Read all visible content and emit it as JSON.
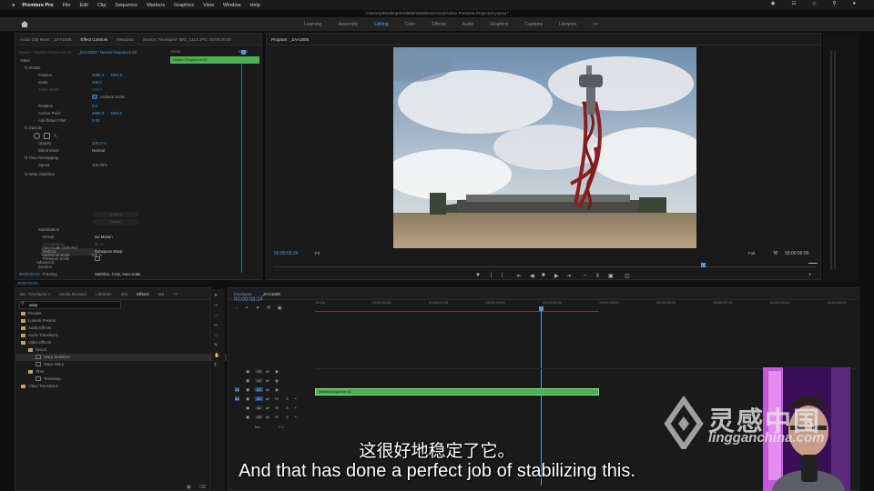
{
  "menubar": {
    "apple": "",
    "app_name": "Premiere Pro",
    "items": [
      "File",
      "Edit",
      "Clip",
      "Sequence",
      "Markers",
      "Graphics",
      "View",
      "Window",
      "Help"
    ]
  },
  "window_title": "/Users/rp/Desktop/ZA00DB/Stabilize(CH11)/Adobe Premiere Projects/1.prproj *",
  "workspaces": [
    "Learning",
    "Assembly",
    "Editing",
    "Color",
    "Effects",
    "Audio",
    "Graphics",
    "Captions",
    "Libraries",
    ">>"
  ],
  "active_workspace": "Editing",
  "effect_controls": {
    "tabs": [
      "Audio Clip Mixer: _ZAA1605",
      "Effect Controls",
      "Metadata",
      "Source: Timelapse: IMG_1414.JPG: 00:00:00:00"
    ],
    "master": "Master * Nested Sequence 03",
    "clip": "_ZAA1605 * Nested Sequence 03",
    "timecode_start": ":00:00",
    "timecode_end": "00:00",
    "clip_bar_label": "Nested Sequence 03",
    "section_video": "Video",
    "motion": "Motion",
    "position_label": "Position",
    "position_x": "2880.0",
    "position_y": "1910.0",
    "scale_label": "Scale",
    "scale_value": "100.0",
    "scale_width_label": "Scale Width",
    "scale_width_value": "100.0",
    "uniform_scale": "Uniform Scale",
    "rotation_label": "Rotation",
    "rotation_value": "0.0",
    "anchor_label": "Anchor Point",
    "anchor_x": "2880.0",
    "anchor_y": "1910.0",
    "antiflicker_label": "Anti-flicker Filter",
    "antiflicker_value": "0.00",
    "opacity_section": "Opacity",
    "opacity_label": "Opacity",
    "opacity_value": "100.0 %",
    "blend_label": "Blend Mode",
    "blend_value": "Normal",
    "remap_section": "Time Remapping",
    "speed_label": "Speed",
    "speed_value": "100.00%",
    "warp_section": "Warp Stabilizer",
    "analyze_btn": "Analyze",
    "cancel_btn": "Cancel",
    "stabilization_label": "Stabilization",
    "result_label": "Result",
    "result_value": "No Motion",
    "smoothness_label": "Smoothness",
    "smoothness_value": "50 %",
    "method_label": "Method",
    "method_value": "Subspace Warp",
    "preserve_label": "Preserve Scale",
    "borders_label": "Borders",
    "framing_label": "Framing",
    "framing_value": "Stabilize, Crop, Auto-scale",
    "autoscale_label": "Auto-scale (100.0%)",
    "addscale_label": "Additional Scale",
    "addscale_value": "100 %",
    "advanced_label": "Advanced",
    "footer_time": "00:00:03:24"
  },
  "program": {
    "tab": "Program: _ZAA1605",
    "timecode": "00:00:03:24",
    "fit": "Fit",
    "quality": "Full",
    "duration": "00:00:05:00"
  },
  "project_panel": {
    "tabs": [
      "Bin: Timelapse 1",
      "Media Browser",
      "Libraries",
      "Info",
      "Effects",
      "Ma",
      ">>"
    ],
    "active": "Effects",
    "search_value": "warp",
    "tree": [
      {
        "label": "Presets",
        "level": 0,
        "type": "folder"
      },
      {
        "label": "Lumetri Presets",
        "level": 0,
        "type": "folder"
      },
      {
        "label": "Audio Effects",
        "level": 0,
        "type": "folder"
      },
      {
        "label": "Audio Transitions",
        "level": 0,
        "type": "folder"
      },
      {
        "label": "Video Effects",
        "level": 0,
        "type": "folder"
      },
      {
        "label": "Distort",
        "level": 1,
        "type": "folder"
      },
      {
        "label": "Warp Stabilizer",
        "level": 2,
        "type": "effect",
        "selected": true
      },
      {
        "label": "Wave Warp",
        "level": 2,
        "type": "effect"
      },
      {
        "label": "Time",
        "level": 1,
        "type": "folder"
      },
      {
        "label": "Timewarp",
        "level": 2,
        "type": "effect"
      },
      {
        "label": "Video Transitions",
        "level": 0,
        "type": "folder"
      }
    ]
  },
  "timeline": {
    "tabs": [
      "Timelapse",
      "_ZAA1605"
    ],
    "timecode": "00:00:03:24",
    "ruler": [
      ":00:00",
      "00:00:01:00",
      "00:00:02:00",
      "00:00:03:00",
      "00:00:04:00",
      "00:00:05:00",
      "00:00:06:00",
      "00:00:07:00",
      "00:00:08:00",
      "00:00:09:00"
    ],
    "video_tracks": [
      "V3",
      "V2",
      "V1"
    ],
    "audio_tracks": [
      "A1",
      "A2",
      "A3"
    ],
    "master_label": "Mix",
    "master_value": "0.0",
    "clip_label": "Nested Sequence 03"
  },
  "subtitle": {
    "cn": "这很好地稳定了它。",
    "en": "And that has done a perfect job of stabilizing this."
  },
  "watermark": {
    "name": "灵感中国",
    "url": "lingganchina.com"
  },
  "colors": {
    "accent": "#4d9bdc",
    "clip_green": "#4caf50",
    "playhead": "#4d9bdc"
  }
}
